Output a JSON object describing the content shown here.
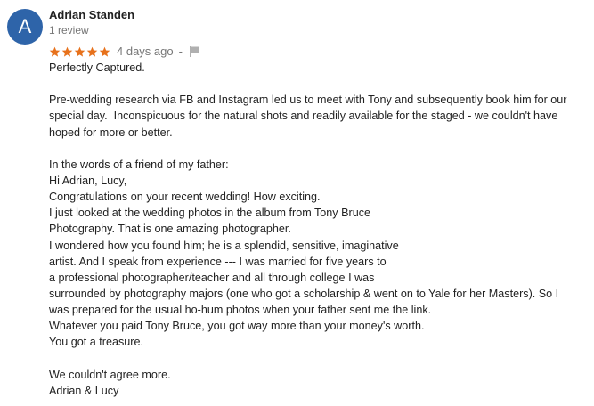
{
  "review": {
    "avatar_letter": "A",
    "avatar_color": "#2e64a9",
    "author_name": "Adrian Standen",
    "review_count": "1 review",
    "rating": 5,
    "rating_max": 5,
    "star_color": "#e7711b",
    "date": "4 days ago",
    "separator": "-",
    "flag_icon": "flag-icon",
    "lines": [
      "Perfectly Captured.",
      "",
      "Pre-wedding research via FB and Instagram led us to meet with Tony and subsequently book him for our",
      "special day.  Inconspicuous for the natural shots and readily available for the staged - we couldn't have",
      "hoped for more or better.",
      "",
      "In the words of a friend of my father:",
      "Hi Adrian, Lucy,",
      "Congratulations on your recent wedding! How exciting.",
      "I just looked at the wedding photos in the album from Tony Bruce",
      "Photography. That is one amazing photographer.",
      "I wondered how you found him; he is a splendid, sensitive, imaginative",
      "artist. And I speak from experience --- I was married for five years to",
      "a professional photographer/teacher and all through college I was",
      "surrounded by photography majors (one who got a scholarship & went on to Yale for her Masters). So I",
      "was prepared for the usual ho-hum photos when your father sent me the link.",
      "Whatever you paid Tony Bruce, you got way more than your money's worth.",
      "You got a treasure.",
      "",
      "We couldn't agree more.",
      "Adrian & Lucy"
    ]
  }
}
